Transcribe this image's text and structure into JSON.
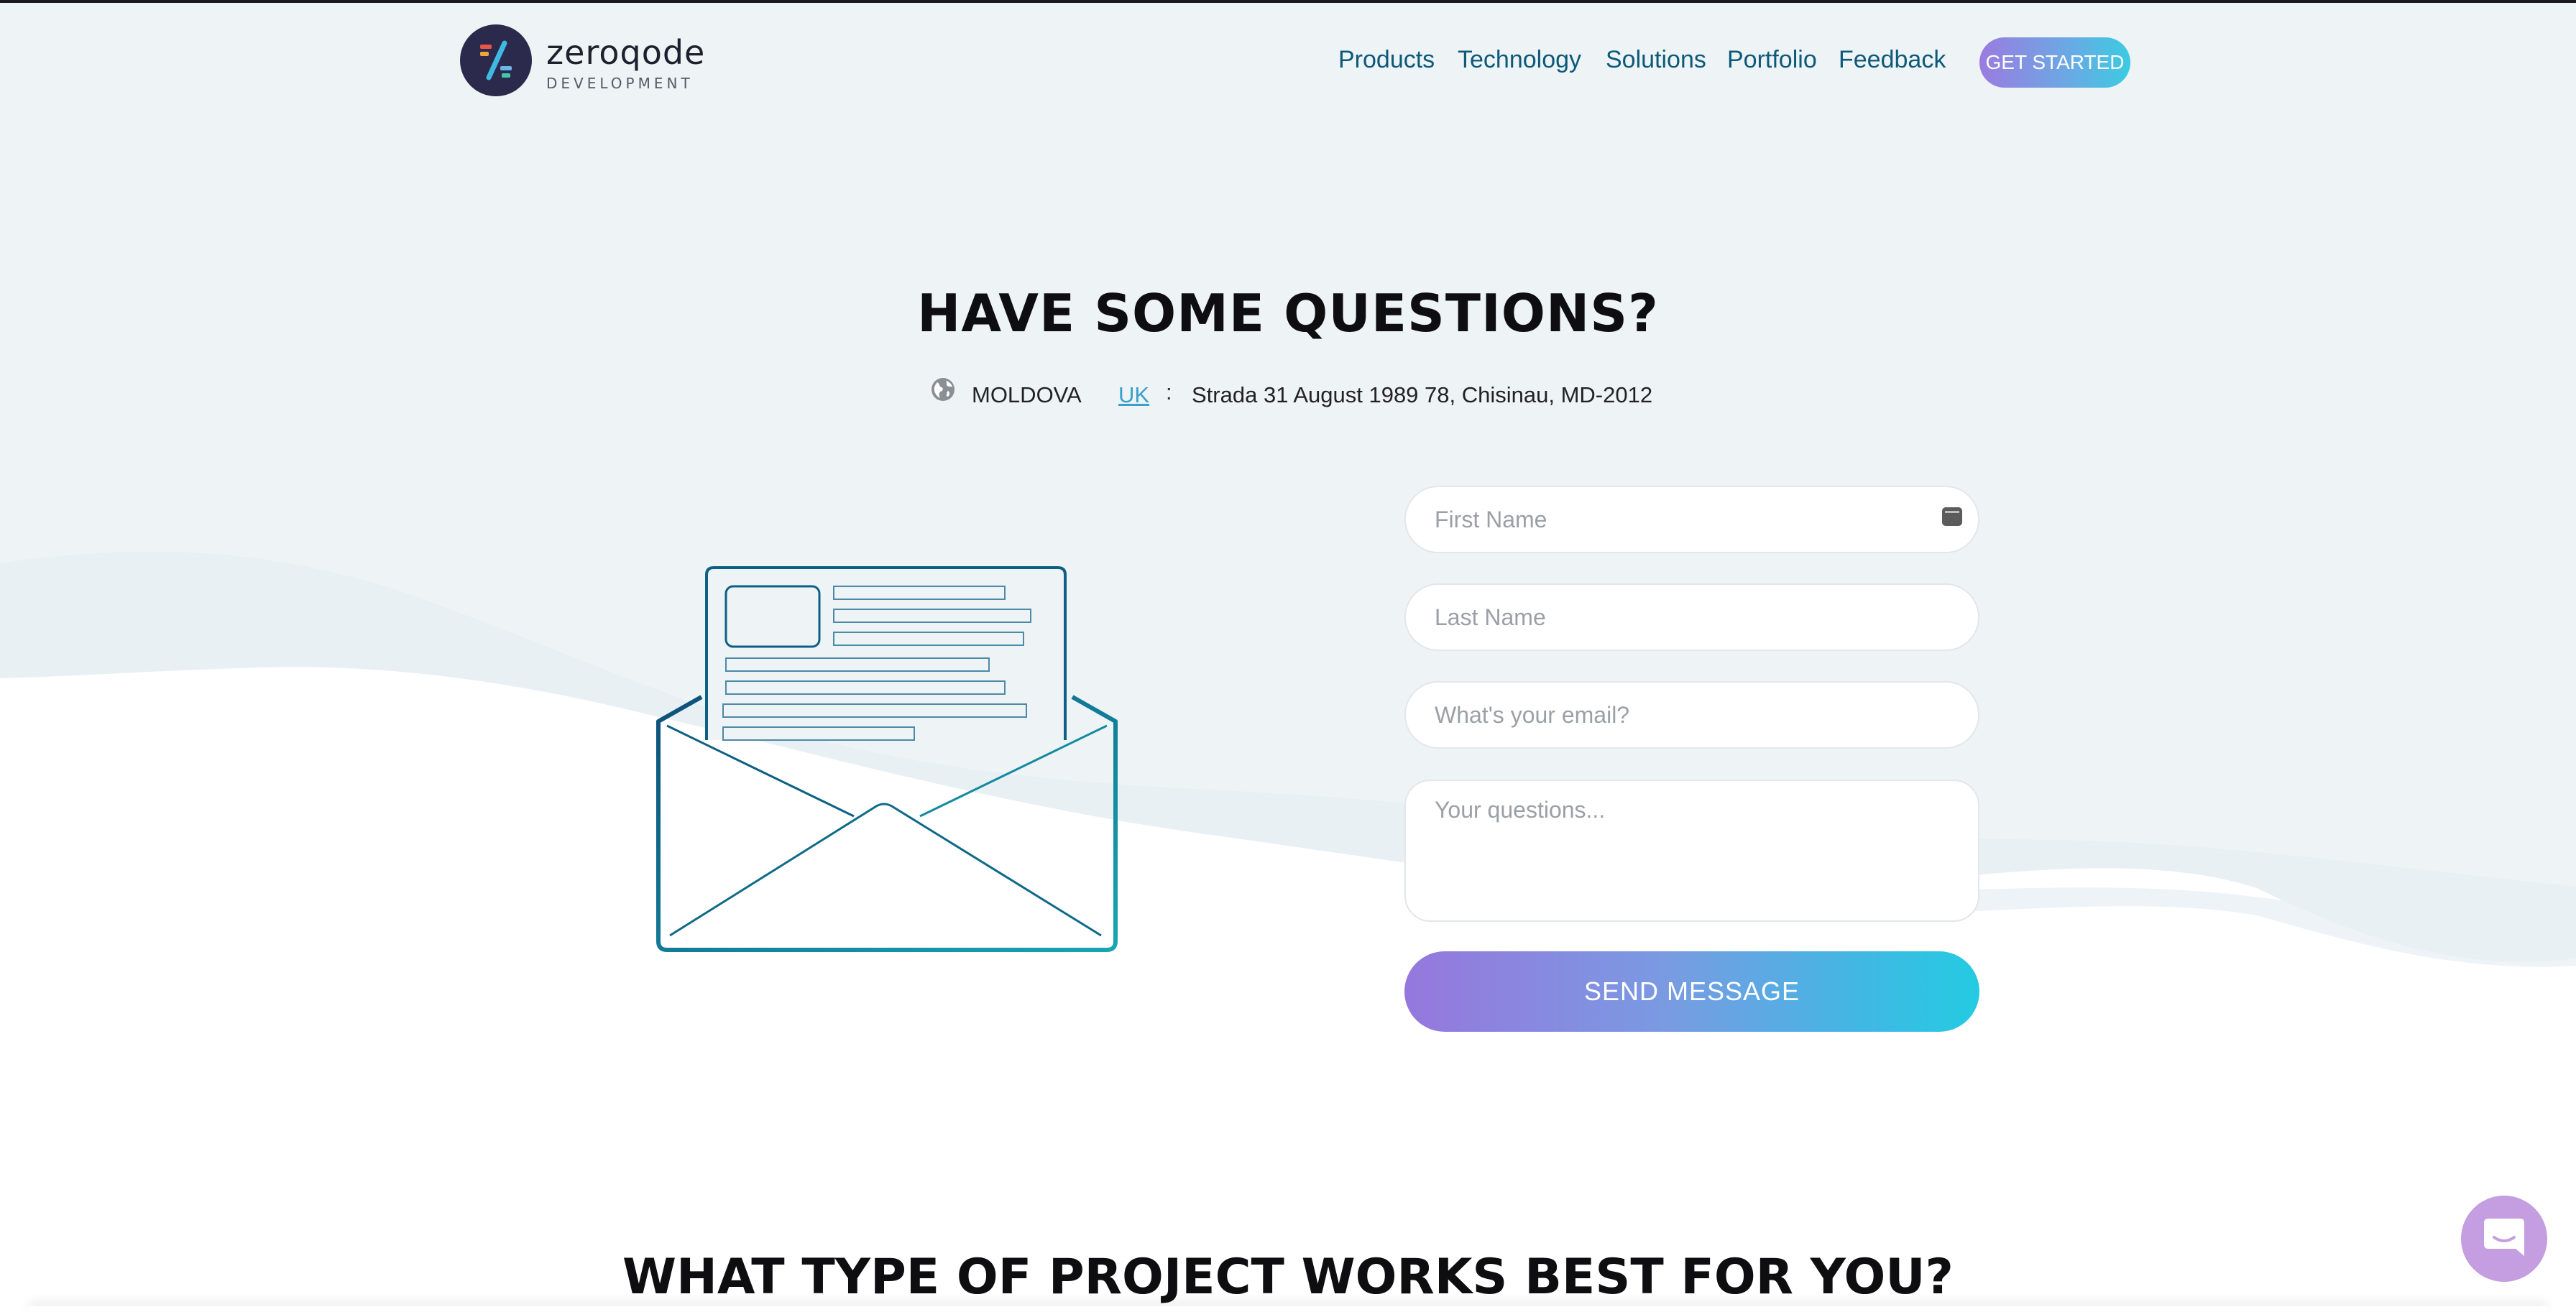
{
  "brand": {
    "name": "zeroqode",
    "subtitle": "DEVELOPMENT"
  },
  "nav": {
    "items": [
      {
        "label": "Products"
      },
      {
        "label": "Technology"
      },
      {
        "label": "Solutions"
      },
      {
        "label": "Portfolio"
      },
      {
        "label": "Feedback"
      }
    ],
    "cta_label": "GET STARTED"
  },
  "contact": {
    "heading": "HAVE SOME QUESTIONS?",
    "country_active": "MOLDOVA",
    "country_link": "UK",
    "separator": ":",
    "address": "Strada 31 August 1989 78, Chisinau, MD-2012"
  },
  "form": {
    "first_name_placeholder": "First Name",
    "last_name_placeholder": "Last Name",
    "email_placeholder": "What's your email?",
    "questions_placeholder": "Your questions...",
    "submit_label": "SEND MESSAGE"
  },
  "next_section": {
    "heading": "WHAT TYPE OF PROJECT WORKS BEST FOR YOU?"
  },
  "colors": {
    "page_background": "#eef3f6",
    "nav_text": "#0d5a78",
    "link": "#3aa0c8",
    "gradient_start": "#9677dd",
    "gradient_end": "#24cbe2",
    "chat_widget": "#c49ee0"
  },
  "icons": {
    "logo": "zeroqode-logo-icon",
    "globe": "globe-icon",
    "autofill": "password-manager-icon",
    "envelope": "open-envelope-illustration",
    "chat": "chat-bubble-icon"
  }
}
